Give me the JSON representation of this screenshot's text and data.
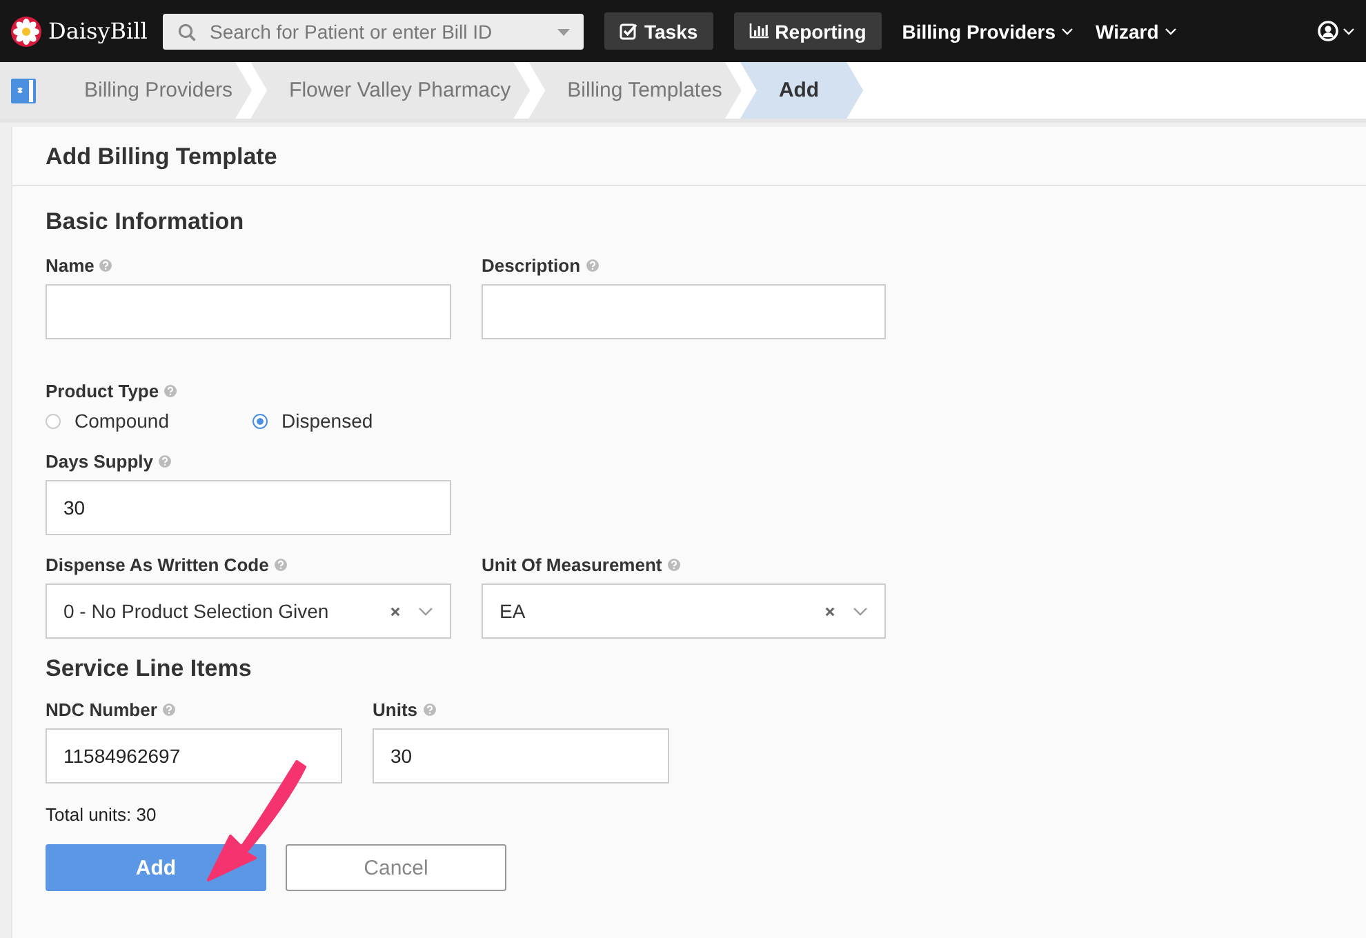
{
  "navbar": {
    "brand": "DaisyBill",
    "search": {
      "placeholder": "Search for Patient or enter Bill ID"
    },
    "buttons": [
      {
        "kind": "tasks",
        "label": "Tasks"
      },
      {
        "kind": "reporting",
        "label": "Reporting"
      }
    ],
    "menus": [
      "Billing Providers",
      "Wizard"
    ]
  },
  "breadcrumb": [
    {
      "label": "Billing Providers",
      "selected": false
    },
    {
      "label": "Flower Valley Pharmacy",
      "selected": false
    },
    {
      "label": "Billing Templates",
      "selected": false
    },
    {
      "label": "Add",
      "selected": true
    }
  ],
  "form": {
    "title": "Add Billing Template",
    "basic": {
      "heading": "Basic Information",
      "name": {
        "label": "Name"
      },
      "description": {
        "label": "Description"
      },
      "product_type": {
        "label": "Product Type",
        "options": [
          {
            "label": "Compound",
            "selected": false
          },
          {
            "label": "Dispensed",
            "selected": true
          }
        ]
      },
      "days_supply": {
        "label": "Days Supply",
        "value": "30"
      },
      "daw_code": {
        "label": "Dispense As Written Code",
        "value": "0 - No Product Selection Given"
      },
      "unit": {
        "label": "Unit Of Measurement",
        "value": "EA"
      }
    },
    "service": {
      "heading": "Service Line Items",
      "ndc": {
        "label": "NDC Number",
        "value": "11584962697"
      },
      "units": {
        "label": "Units",
        "value": "30"
      },
      "total": "Total units: 30"
    },
    "buttons": {
      "submit": "Add",
      "cancel": "Cancel"
    }
  }
}
